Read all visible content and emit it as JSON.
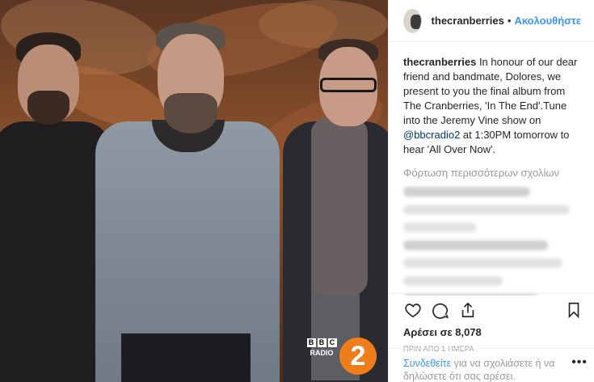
{
  "post": {
    "username": "thecranberries",
    "follow_label": "Ακολουθήστε",
    "caption_username": "thecranberries",
    "caption_text_1": " In honour of our dear friend and bandmate, Dolores, we present to you the final album from The Cranberries, 'In The End'.Tune into the Jeremy Vine show on ",
    "caption_mention": "@bbcradio2",
    "caption_text_2": " at 1:30PM tomorrow to hear 'All Over Now'.",
    "load_more": "Φόρτωση περισσότερων σχολίων",
    "likes": "Αρέσει σε 8,078",
    "time": "ΠΡΙΝ ΑΠΟ 1 ΗΜΕΡΑ",
    "login_link": "Συνδεθείτε",
    "login_text": " για να σχολιάσετε ή να δηλώσετε ότι σας αρέσει.",
    "more_label": "•••"
  },
  "photo": {
    "bbc_letters": [
      "B",
      "B",
      "C"
    ],
    "radio_label": "RADIO",
    "radio_number": "2"
  },
  "icons": {
    "like": "heart-icon",
    "comment": "comment-icon",
    "share": "share-icon",
    "save": "bookmark-icon"
  },
  "colors": {
    "link_blue": "#3897f0",
    "radio2_orange": "#ef7d1a"
  }
}
